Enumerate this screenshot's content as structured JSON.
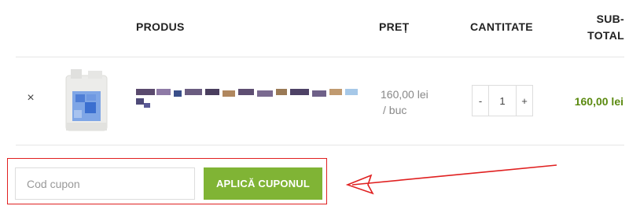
{
  "table": {
    "headers": {
      "product": "PRODUS",
      "price": "PREȚ",
      "quantity": "CANTITATE",
      "subtotal_line1": "SUB-",
      "subtotal_line2": "TOTAL"
    }
  },
  "cart_item": {
    "remove_symbol": "×",
    "thumbnail_icon": "product-canister-image",
    "name_pixelated": true,
    "price": "160,00 lei",
    "price_unit": "/ buc",
    "quantity": "1",
    "decrement_symbol": "-",
    "increment_symbol": "+",
    "subtotal": "160,00 lei"
  },
  "coupon": {
    "placeholder": "Cod cupon",
    "value": "",
    "button_label": "APLICĂ CUPONUL"
  },
  "colors": {
    "accent": "#80b435",
    "subtotal_text": "#5b8a10",
    "annotation": "#e02020"
  },
  "annotation": {
    "type": "red-outline-with-arrow",
    "target": "coupon-form"
  }
}
